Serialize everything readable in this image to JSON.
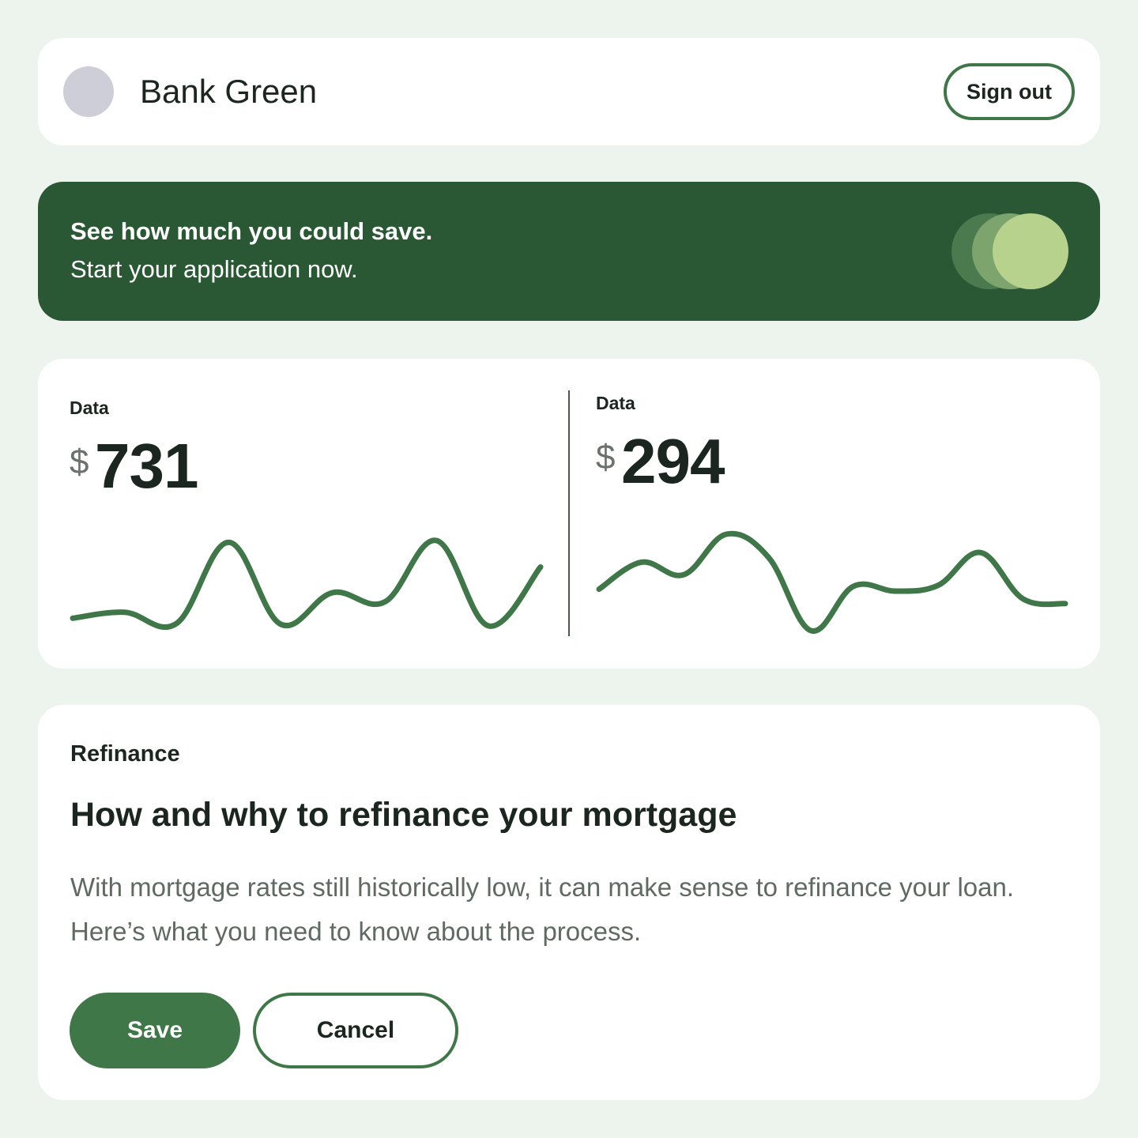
{
  "header": {
    "brand": "Bank Green",
    "sign_out_label": "Sign out"
  },
  "promo": {
    "headline": "See how much you could save.",
    "subline": "Start your application now."
  },
  "stats": [
    {
      "label": "Data",
      "currency": "$",
      "value": "731",
      "sparkline": [
        0.09,
        0.16,
        0.03,
        0.98,
        0.02,
        0.39,
        0.28,
        1.0,
        0.0,
        0.69
      ]
    },
    {
      "label": "Data",
      "currency": "$",
      "value": "294",
      "sparkline": [
        0.43,
        0.71,
        0.58,
        1.0,
        0.76,
        0.0,
        0.46,
        0.41,
        0.47,
        0.81,
        0.33,
        0.28
      ]
    }
  ],
  "article": {
    "tag": "Refinance",
    "title": "How and why to refinance your mortgage",
    "body": "With mortgage rates still historically low, it can make sense to refinance your loan. Here’s what you need to know about the process.",
    "save_label": "Save",
    "cancel_label": "Cancel"
  },
  "colors": {
    "background": "#edf3ed",
    "brand_dark": "#2b5834",
    "accent": "#3f7748",
    "toggle_light": "#b6d28c"
  }
}
